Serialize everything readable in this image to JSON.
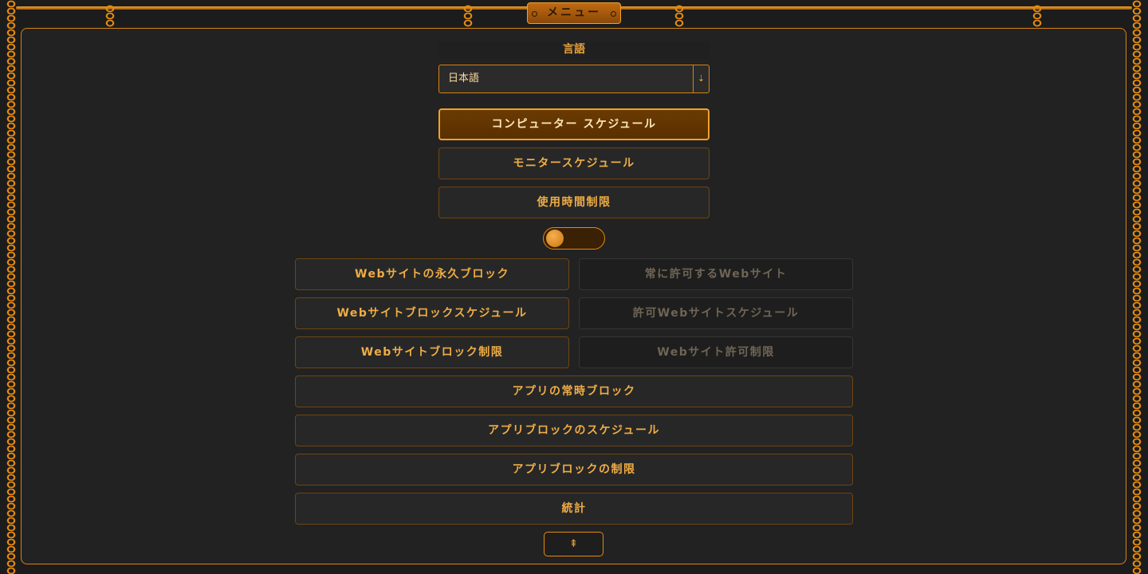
{
  "header": {
    "menu_label": "メニュー"
  },
  "language": {
    "label": "言語",
    "selected": "日本語",
    "arrow_glyph": "⇣"
  },
  "schedule_buttons": [
    {
      "label": "コンピューター スケジュール",
      "active": true
    },
    {
      "label": "モニタースケジュール",
      "active": false
    },
    {
      "label": "使用時間制限",
      "active": false
    }
  ],
  "mode_toggle": {
    "on": false
  },
  "website_block": [
    {
      "label": "Webサイトの永久ブロック"
    },
    {
      "label": "Webサイトブロックスケジュール"
    },
    {
      "label": "Webサイトブロック制限"
    }
  ],
  "website_allow": [
    {
      "label": "常に許可するWebサイト",
      "disabled": true
    },
    {
      "label": "許可Webサイトスケジュール",
      "disabled": true
    },
    {
      "label": "Webサイト許可制限",
      "disabled": true
    }
  ],
  "app_buttons": [
    {
      "label": "アプリの常時ブロック"
    },
    {
      "label": "アプリブロックのスケジュール"
    },
    {
      "label": "アプリブロックの制限"
    },
    {
      "label": "統計"
    }
  ],
  "scroll_top": {
    "glyph": "⇞"
  },
  "colors": {
    "accent": "#e48a10",
    "text": "#f0ad45",
    "background": "#1c1c1c",
    "disabled_text": "#6f6555"
  }
}
